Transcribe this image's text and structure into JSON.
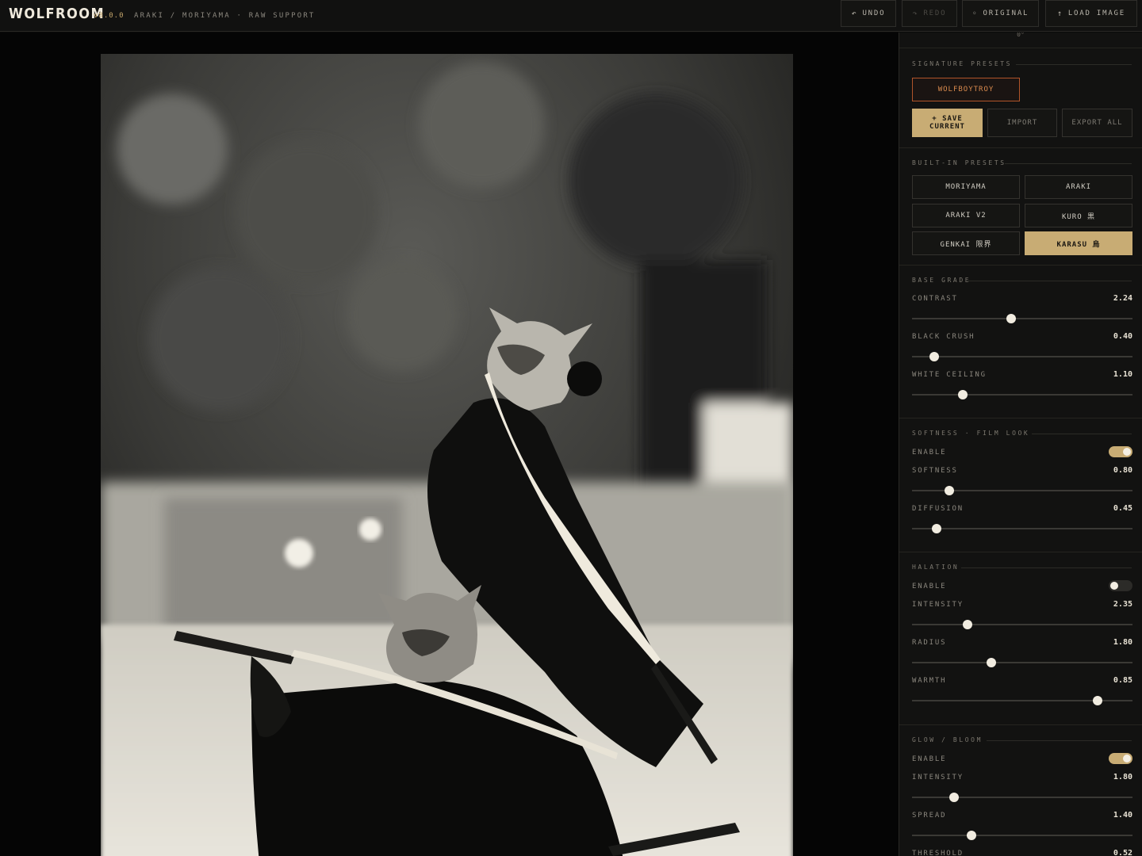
{
  "header": {
    "logo": "WOLFROOM",
    "version": "v8.0.0",
    "subtitle": "ARAKI / MORIYAMA · RAW SUPPORT",
    "buttons": {
      "undo": "UNDO",
      "redo": "REDO",
      "original": "ORIGINAL",
      "load": "LOAD IMAGE"
    },
    "icons": {
      "undo": "↶",
      "redo": "↷",
      "original": "◦",
      "load": "↑"
    }
  },
  "rotation_value": "0°",
  "signature": {
    "title": "SIGNATURE PRESETS",
    "preset": "WOLFBOYTROY",
    "save_label": "+ SAVE CURRENT",
    "import_label": "IMPORT",
    "export_label": "EXPORT ALL"
  },
  "builtin": {
    "title": "BUILT-IN PRESETS",
    "presets": [
      "MORIYAMA",
      "ARAKI",
      "ARAKI V2",
      "KURO 黒",
      "GENKAI 限界",
      "KARASU 烏"
    ],
    "active": "KARASU 烏"
  },
  "base_grade": {
    "title": "BASE GRADE",
    "contrast": {
      "label": "CONTRAST",
      "value": "2.24",
      "pos": 0.45
    },
    "black_crush": {
      "label": "BLACK CRUSH",
      "value": "0.40",
      "pos": 0.1
    },
    "white_ceiling": {
      "label": "WHITE CEILING",
      "value": "1.10",
      "pos": 0.23
    }
  },
  "softness": {
    "title": "SOFTNESS · FILM LOOK",
    "enable_label": "ENABLE",
    "enabled": true,
    "softness": {
      "label": "SOFTNESS",
      "value": "0.80",
      "pos": 0.17
    },
    "diffusion": {
      "label": "DIFFUSION",
      "value": "0.45",
      "pos": 0.11
    }
  },
  "halation": {
    "title": "HALATION",
    "enable_label": "ENABLE",
    "enabled": false,
    "intensity": {
      "label": "INTENSITY",
      "value": "2.35",
      "pos": 0.25
    },
    "radius": {
      "label": "RADIUS",
      "value": "1.80",
      "pos": 0.36
    },
    "warmth": {
      "label": "WARMTH",
      "value": "0.85",
      "pos": 0.84
    }
  },
  "glow": {
    "title": "GLOW / BLOOM",
    "enable_label": "ENABLE",
    "enabled": true,
    "intensity": {
      "label": "INTENSITY",
      "value": "1.80",
      "pos": 0.19
    },
    "spread": {
      "label": "SPREAD",
      "value": "1.40",
      "pos": 0.27
    },
    "threshold": {
      "label": "THRESHOLD",
      "value": "0.52"
    }
  },
  "colors": {
    "accent_gold": "#c8ac74",
    "signature_orange": "#b0542a",
    "background": "#0a0a09",
    "panel": "#121211"
  }
}
